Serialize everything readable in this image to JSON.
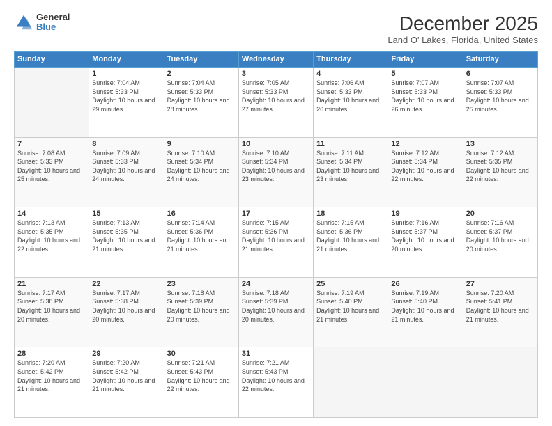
{
  "logo": {
    "general": "General",
    "blue": "Blue"
  },
  "title": "December 2025",
  "subtitle": "Land O' Lakes, Florida, United States",
  "days_header": [
    "Sunday",
    "Monday",
    "Tuesday",
    "Wednesday",
    "Thursday",
    "Friday",
    "Saturday"
  ],
  "weeks": [
    [
      {
        "num": "",
        "empty": true
      },
      {
        "num": "1",
        "sunrise": "Sunrise: 7:04 AM",
        "sunset": "Sunset: 5:33 PM",
        "daylight": "Daylight: 10 hours and 29 minutes."
      },
      {
        "num": "2",
        "sunrise": "Sunrise: 7:04 AM",
        "sunset": "Sunset: 5:33 PM",
        "daylight": "Daylight: 10 hours and 28 minutes."
      },
      {
        "num": "3",
        "sunrise": "Sunrise: 7:05 AM",
        "sunset": "Sunset: 5:33 PM",
        "daylight": "Daylight: 10 hours and 27 minutes."
      },
      {
        "num": "4",
        "sunrise": "Sunrise: 7:06 AM",
        "sunset": "Sunset: 5:33 PM",
        "daylight": "Daylight: 10 hours and 26 minutes."
      },
      {
        "num": "5",
        "sunrise": "Sunrise: 7:07 AM",
        "sunset": "Sunset: 5:33 PM",
        "daylight": "Daylight: 10 hours and 26 minutes."
      },
      {
        "num": "6",
        "sunrise": "Sunrise: 7:07 AM",
        "sunset": "Sunset: 5:33 PM",
        "daylight": "Daylight: 10 hours and 25 minutes."
      }
    ],
    [
      {
        "num": "7",
        "sunrise": "Sunrise: 7:08 AM",
        "sunset": "Sunset: 5:33 PM",
        "daylight": "Daylight: 10 hours and 25 minutes."
      },
      {
        "num": "8",
        "sunrise": "Sunrise: 7:09 AM",
        "sunset": "Sunset: 5:33 PM",
        "daylight": "Daylight: 10 hours and 24 minutes."
      },
      {
        "num": "9",
        "sunrise": "Sunrise: 7:10 AM",
        "sunset": "Sunset: 5:34 PM",
        "daylight": "Daylight: 10 hours and 24 minutes."
      },
      {
        "num": "10",
        "sunrise": "Sunrise: 7:10 AM",
        "sunset": "Sunset: 5:34 PM",
        "daylight": "Daylight: 10 hours and 23 minutes."
      },
      {
        "num": "11",
        "sunrise": "Sunrise: 7:11 AM",
        "sunset": "Sunset: 5:34 PM",
        "daylight": "Daylight: 10 hours and 23 minutes."
      },
      {
        "num": "12",
        "sunrise": "Sunrise: 7:12 AM",
        "sunset": "Sunset: 5:34 PM",
        "daylight": "Daylight: 10 hours and 22 minutes."
      },
      {
        "num": "13",
        "sunrise": "Sunrise: 7:12 AM",
        "sunset": "Sunset: 5:35 PM",
        "daylight": "Daylight: 10 hours and 22 minutes."
      }
    ],
    [
      {
        "num": "14",
        "sunrise": "Sunrise: 7:13 AM",
        "sunset": "Sunset: 5:35 PM",
        "daylight": "Daylight: 10 hours and 22 minutes."
      },
      {
        "num": "15",
        "sunrise": "Sunrise: 7:13 AM",
        "sunset": "Sunset: 5:35 PM",
        "daylight": "Daylight: 10 hours and 21 minutes."
      },
      {
        "num": "16",
        "sunrise": "Sunrise: 7:14 AM",
        "sunset": "Sunset: 5:36 PM",
        "daylight": "Daylight: 10 hours and 21 minutes."
      },
      {
        "num": "17",
        "sunrise": "Sunrise: 7:15 AM",
        "sunset": "Sunset: 5:36 PM",
        "daylight": "Daylight: 10 hours and 21 minutes."
      },
      {
        "num": "18",
        "sunrise": "Sunrise: 7:15 AM",
        "sunset": "Sunset: 5:36 PM",
        "daylight": "Daylight: 10 hours and 21 minutes."
      },
      {
        "num": "19",
        "sunrise": "Sunrise: 7:16 AM",
        "sunset": "Sunset: 5:37 PM",
        "daylight": "Daylight: 10 hours and 20 minutes."
      },
      {
        "num": "20",
        "sunrise": "Sunrise: 7:16 AM",
        "sunset": "Sunset: 5:37 PM",
        "daylight": "Daylight: 10 hours and 20 minutes."
      }
    ],
    [
      {
        "num": "21",
        "sunrise": "Sunrise: 7:17 AM",
        "sunset": "Sunset: 5:38 PM",
        "daylight": "Daylight: 10 hours and 20 minutes."
      },
      {
        "num": "22",
        "sunrise": "Sunrise: 7:17 AM",
        "sunset": "Sunset: 5:38 PM",
        "daylight": "Daylight: 10 hours and 20 minutes."
      },
      {
        "num": "23",
        "sunrise": "Sunrise: 7:18 AM",
        "sunset": "Sunset: 5:39 PM",
        "daylight": "Daylight: 10 hours and 20 minutes."
      },
      {
        "num": "24",
        "sunrise": "Sunrise: 7:18 AM",
        "sunset": "Sunset: 5:39 PM",
        "daylight": "Daylight: 10 hours and 20 minutes."
      },
      {
        "num": "25",
        "sunrise": "Sunrise: 7:19 AM",
        "sunset": "Sunset: 5:40 PM",
        "daylight": "Daylight: 10 hours and 21 minutes."
      },
      {
        "num": "26",
        "sunrise": "Sunrise: 7:19 AM",
        "sunset": "Sunset: 5:40 PM",
        "daylight": "Daylight: 10 hours and 21 minutes."
      },
      {
        "num": "27",
        "sunrise": "Sunrise: 7:20 AM",
        "sunset": "Sunset: 5:41 PM",
        "daylight": "Daylight: 10 hours and 21 minutes."
      }
    ],
    [
      {
        "num": "28",
        "sunrise": "Sunrise: 7:20 AM",
        "sunset": "Sunset: 5:42 PM",
        "daylight": "Daylight: 10 hours and 21 minutes."
      },
      {
        "num": "29",
        "sunrise": "Sunrise: 7:20 AM",
        "sunset": "Sunset: 5:42 PM",
        "daylight": "Daylight: 10 hours and 21 minutes."
      },
      {
        "num": "30",
        "sunrise": "Sunrise: 7:21 AM",
        "sunset": "Sunset: 5:43 PM",
        "daylight": "Daylight: 10 hours and 22 minutes."
      },
      {
        "num": "31",
        "sunrise": "Sunrise: 7:21 AM",
        "sunset": "Sunset: 5:43 PM",
        "daylight": "Daylight: 10 hours and 22 minutes."
      },
      {
        "num": "",
        "empty": true
      },
      {
        "num": "",
        "empty": true
      },
      {
        "num": "",
        "empty": true
      }
    ]
  ]
}
